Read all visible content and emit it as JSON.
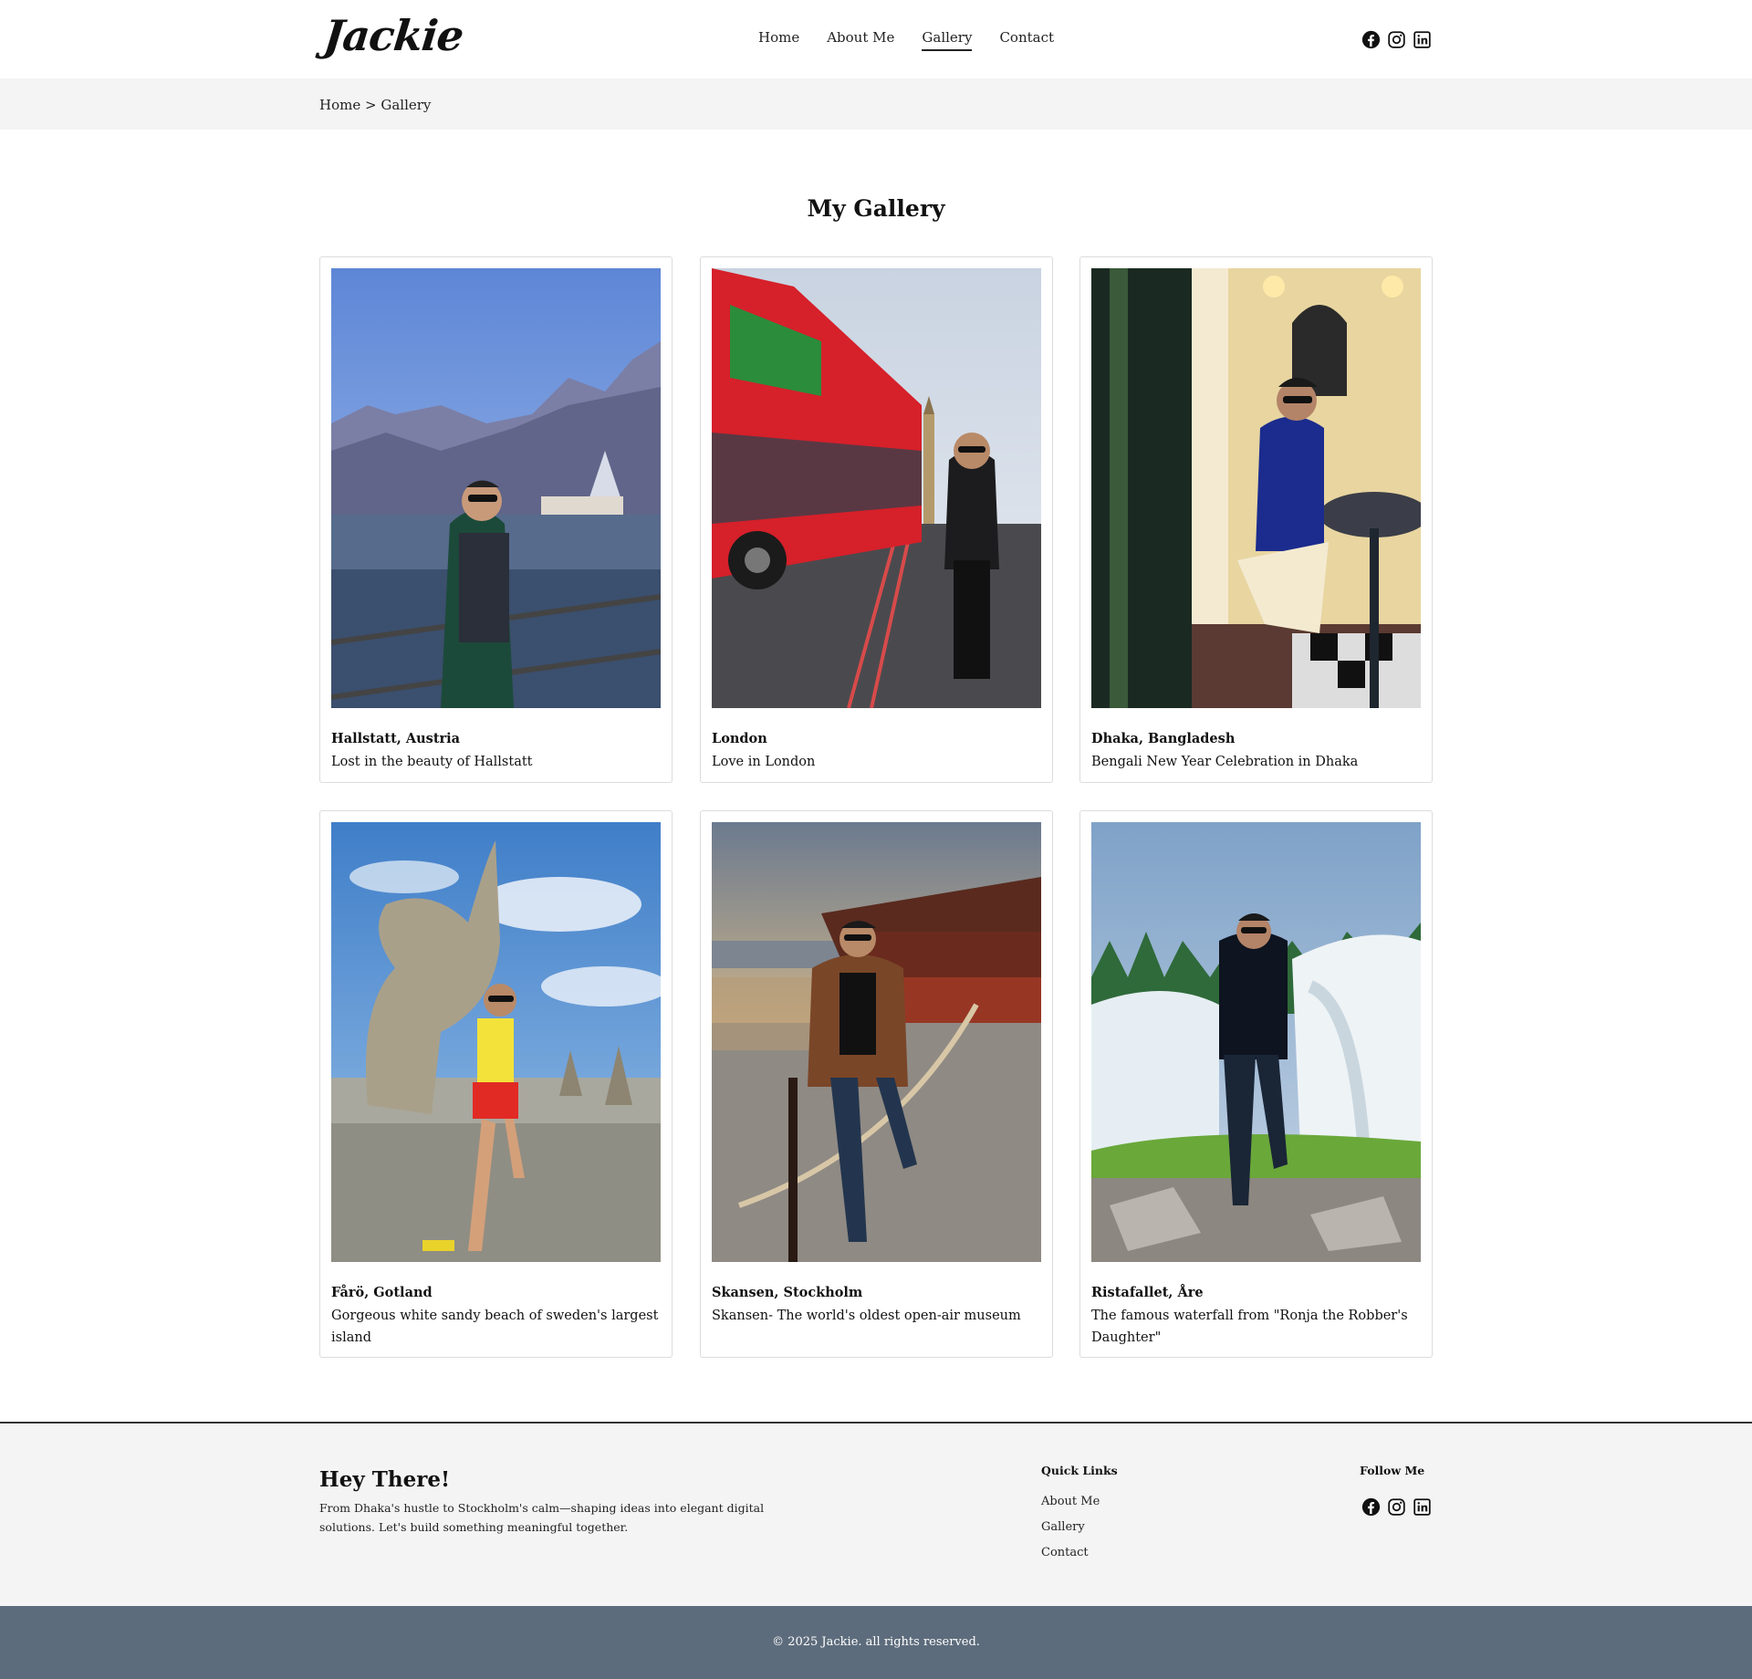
{
  "header": {
    "logo": "Jackie",
    "nav": [
      {
        "label": "Home",
        "active": false
      },
      {
        "label": "About Me",
        "active": false
      },
      {
        "label": "Gallery",
        "active": true
      },
      {
        "label": "Contact",
        "active": false
      }
    ],
    "social_icons": [
      "facebook-icon",
      "instagram-icon",
      "linkedin-icon"
    ]
  },
  "breadcrumb": {
    "home": "Home",
    "separator": ">",
    "current": "Gallery"
  },
  "gallery": {
    "title": "My Gallery",
    "items": [
      {
        "title": "Hallstatt, Austria",
        "description": "Lost in the beauty of Hallstatt"
      },
      {
        "title": "London",
        "description": "Love in London"
      },
      {
        "title": "Dhaka, Bangladesh",
        "description": "Bengali New Year Celebration in Dhaka"
      },
      {
        "title": "Fårö, Gotland",
        "description": "Gorgeous white sandy beach of sweden's largest island"
      },
      {
        "title": "Skansen, Stockholm",
        "description": "Skansen- The world's oldest open-air museum"
      },
      {
        "title": "Ristafallet, Åre",
        "description": "The famous waterfall from \"Ronja the Robber's Daughter\""
      }
    ]
  },
  "footer": {
    "heading": "Hey There!",
    "text": "From Dhaka's hustle to Stockholm's calm—shaping ideas into elegant digital solutions. Let's build something meaningful together.",
    "quick_links_title": "Quick Links",
    "quick_links": [
      "About Me",
      "Gallery",
      "Contact"
    ],
    "follow_title": "Follow Me",
    "copyright": "© 2025 Jackie. all rights reserved."
  },
  "colors": {
    "breadcrumb_bg": "#f4f4f4",
    "footer_bg": "#f4f4f4",
    "copyright_bg": "#5d6c7c"
  }
}
